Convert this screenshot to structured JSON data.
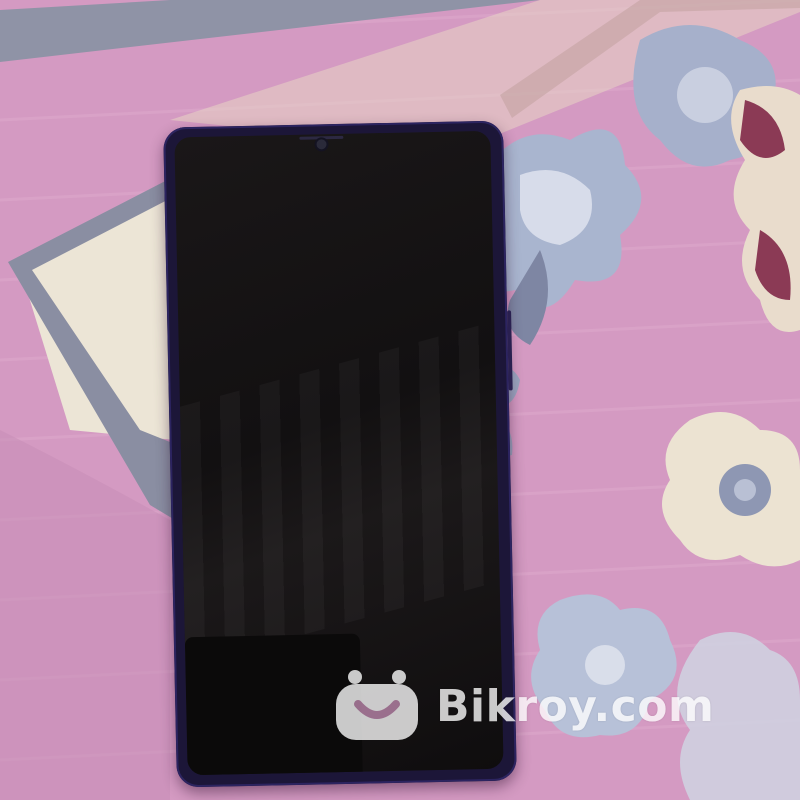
{
  "scene": {
    "subject": "smartphone-on-floral-bedsheet"
  },
  "watermark": {
    "brand_text": "Bikroy.com",
    "icon": "smiley-bag-logo-icon",
    "color": "#ffffff"
  },
  "colors": {
    "bedsheet_pink": "#d49ac2",
    "border_grey": "#8f93a6",
    "phone_frame": "#1c1638",
    "screen": "#141213"
  }
}
